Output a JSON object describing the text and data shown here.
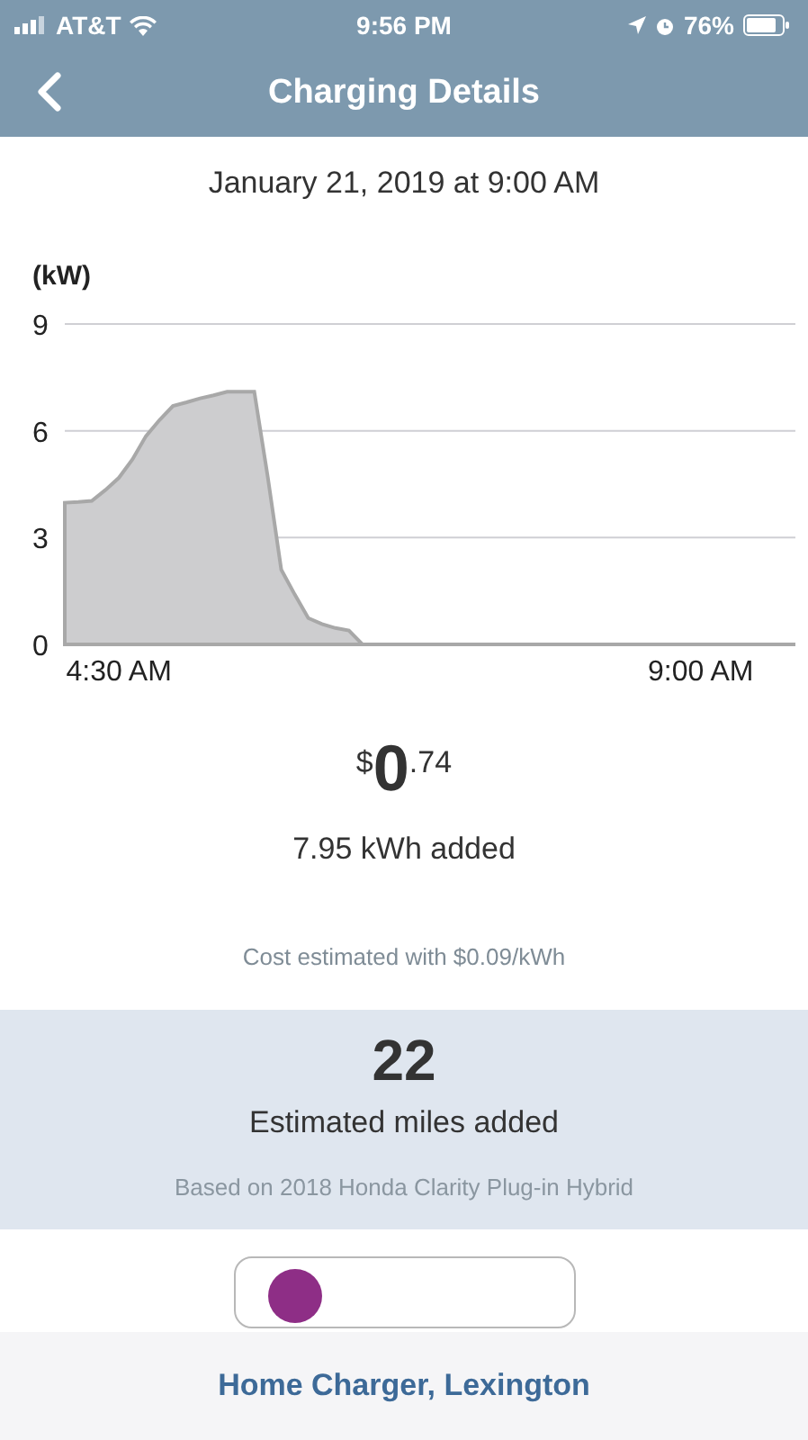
{
  "status_bar": {
    "carrier": "AT&T",
    "time": "9:56 PM",
    "battery": "76%"
  },
  "nav": {
    "title": "Charging Details"
  },
  "date": "January 21, 2019 at 9:00 AM",
  "chart": {
    "chart_data": {
      "type": "area",
      "ylabel": "(kW)",
      "categories": [
        null,
        null,
        null,
        null,
        "4:30 AM",
        null,
        null,
        null,
        null,
        null,
        null,
        null,
        null,
        null,
        null,
        null,
        null,
        null,
        null,
        null,
        null,
        null,
        null,
        null,
        null,
        null,
        null,
        null,
        null,
        null,
        null,
        null,
        null,
        null,
        null,
        null,
        null,
        null,
        null,
        null,
        null,
        null,
        null,
        null,
        null,
        null,
        null,
        "9:00 AM",
        null,
        null,
        null,
        null,
        null,
        null,
        null
      ],
      "series": [
        {
          "color": "#a8a8a8",
          "values": [
            3.98,
            4.0,
            4.03,
            4.34,
            4.68,
            5.2,
            5.85,
            6.3,
            6.7,
            6.8,
            6.91,
            7.0,
            7.1,
            7.1,
            7.1,
            4.7,
            2.1,
            1.4,
            0.74,
            0.57,
            0.46,
            0.39,
            0,
            0,
            0,
            0,
            0,
            0,
            0,
            0,
            0,
            0,
            0,
            0,
            0,
            0,
            0,
            0,
            0,
            0,
            0,
            0,
            0,
            0,
            0,
            0,
            0,
            0,
            0,
            0,
            0,
            0,
            0,
            0,
            0
          ]
        }
      ],
      "ylim": [
        0,
        9
      ],
      "yticks": [
        0,
        3,
        6,
        9
      ]
    }
  },
  "cost": {
    "currency": "$",
    "dollars": "0",
    "cents": ".74"
  },
  "energy": "7.95 kWh added",
  "cost_note": "Cost estimated with $0.09/kWh",
  "miles": {
    "value": "22",
    "label": "Estimated miles added",
    "note": "Based on 2018 Honda Clarity Plug-in Hybrid"
  },
  "footer": {
    "link": "Home Charger, Lexington"
  }
}
